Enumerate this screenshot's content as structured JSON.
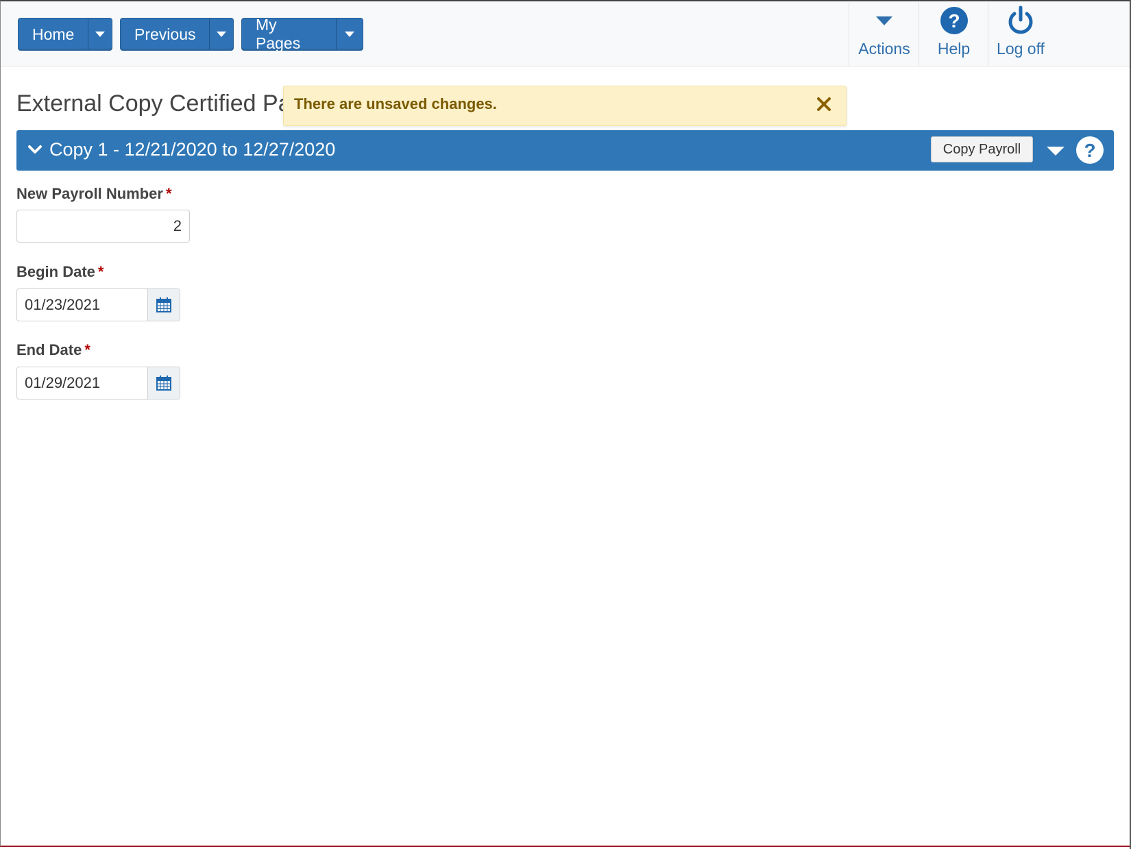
{
  "nav": {
    "home_label": "Home",
    "previous_label": "Previous",
    "mypages_label": "My Pages"
  },
  "toolbar": {
    "actions_label": "Actions",
    "help_label": "Help",
    "logoff_label": "Log off"
  },
  "page": {
    "title": "External Copy Certified Payroll"
  },
  "notification": {
    "message": "There are unsaved changes."
  },
  "panel": {
    "title": "Copy 1 - 12/21/2020 to 12/27/2020",
    "copy_button_label": "Copy Payroll"
  },
  "form": {
    "payroll_number": {
      "label": "New Payroll Number",
      "value": "2"
    },
    "begin_date": {
      "label": "Begin Date",
      "value": "01/23/2021"
    },
    "end_date": {
      "label": "End Date",
      "value": "01/29/2021"
    },
    "required_marker": "*"
  },
  "icons": {
    "actions": "caret-down-icon",
    "help": "question-circle-icon",
    "logoff": "power-icon",
    "close": "close-icon",
    "calendar": "calendar-icon"
  },
  "colors": {
    "primary": "#2f77b6",
    "link": "#2f6fad",
    "warning_bg": "#fdf1c9",
    "warning_text": "#7a5a00",
    "required": "#b30000"
  }
}
